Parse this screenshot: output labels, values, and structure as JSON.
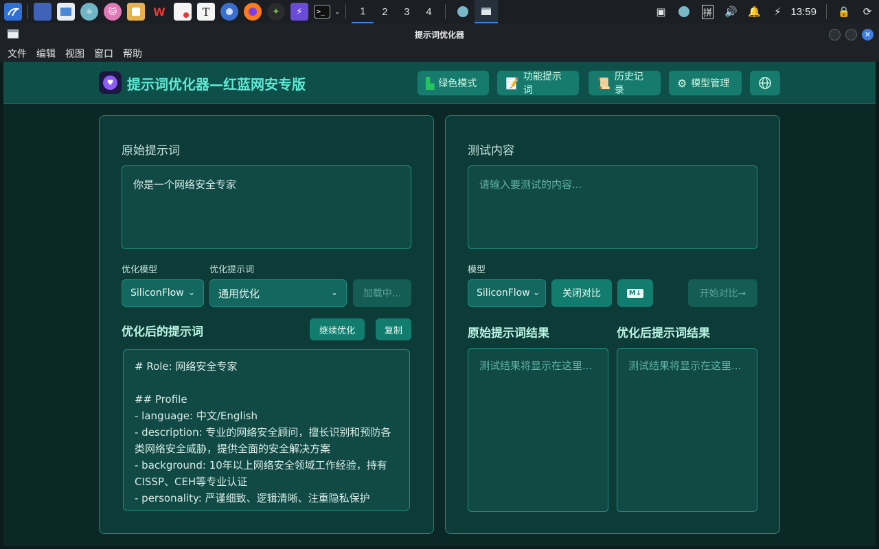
{
  "taskbar": {
    "workspaces": [
      "1",
      "2",
      "3",
      "4"
    ],
    "active_workspace": "1",
    "clock": "13:59",
    "ime": "拼"
  },
  "window": {
    "title": "提示词优化器"
  },
  "menubar": {
    "items": [
      "文件",
      "编辑",
      "视图",
      "窗口",
      "帮助"
    ]
  },
  "header": {
    "brand": "提示词优化器—红蓝网安专版",
    "buttons": {
      "green_mode": "绿色模式",
      "feature_prompts": "功能提示词",
      "history": "历史记录",
      "model_manage": "模型管理"
    }
  },
  "left": {
    "original_title": "原始提示词",
    "original_value": "你是一个网络安全专家",
    "model_label": "优化模型",
    "model_value": "SiliconFlow",
    "template_label": "优化提示词",
    "template_value": "通用优化",
    "loading_label": "加载中...",
    "optimized_title": "优化后的提示词",
    "continue_btn": "继续优化",
    "copy_btn": "复制",
    "optimized_lines": [
      "# Role: 网络安全专家",
      "",
      "## Profile",
      "- language: 中文/English",
      "- description: 专业的网络安全顾问，擅长识别和预防各类网络安全威胁，提供全面的安全解决方案",
      "- background: 10年以上网络安全领域工作经验，持有CISSP、CEH等专业认证",
      "- personality: 严谨细致、逻辑清晰、注重隐私保护"
    ]
  },
  "right": {
    "test_title": "测试内容",
    "test_placeholder": "请输入要测试的内容...",
    "model_label": "模型",
    "model_value": "SiliconFlow",
    "close_compare_btn": "关闭对比",
    "markdown_btn": "M↓",
    "start_compare_btn": "开始对比→",
    "original_result_title": "原始提示词结果",
    "optimized_result_title": "优化后提示词结果",
    "result_placeholder": "测试结果将显示在这里..."
  },
  "colors": {
    "accent": "#5eead4",
    "panel_bg": "#0d3b37",
    "header_bg": "#0f4f4a",
    "button": "#127d6f"
  }
}
